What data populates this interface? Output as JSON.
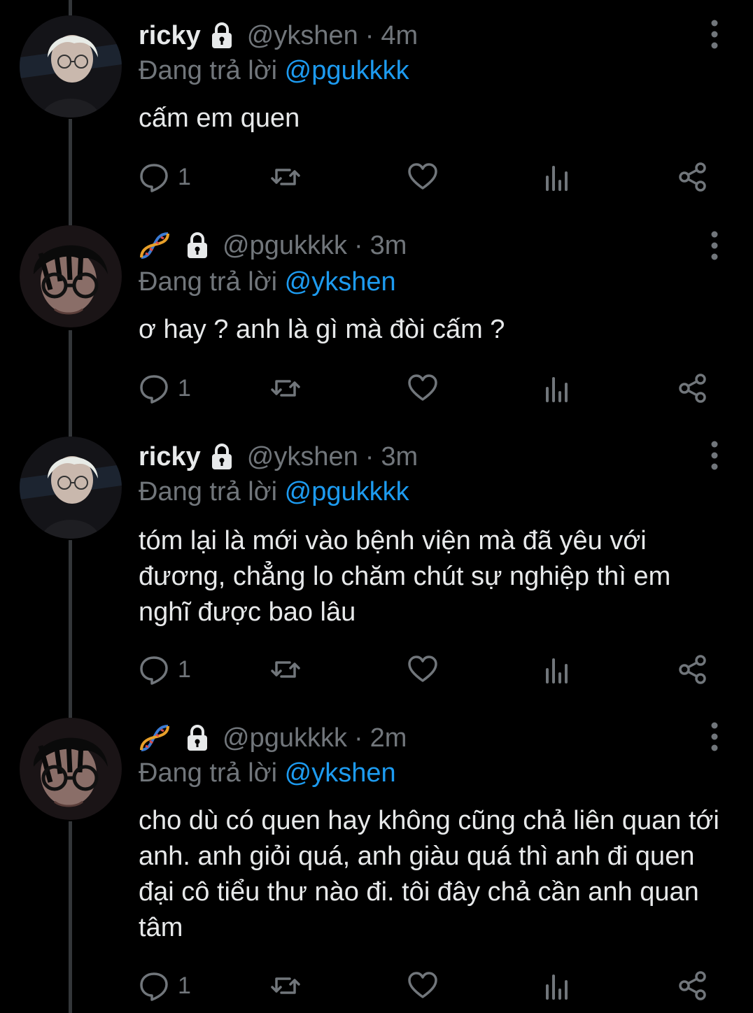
{
  "colors": {
    "background": "#000000",
    "text": "#e7e9ea",
    "muted": "#71767b",
    "mention": "#1d9bf0",
    "thread_line": "#333639"
  },
  "reply_prefix": "Đang trả lời",
  "tweets": [
    {
      "display_name": "ricky",
      "name_icon": "lock-icon",
      "handle": "@ykshen",
      "separator": "·",
      "time": "4m",
      "reply_to": "@pgukkkk",
      "text": "cấm em quen",
      "reply_count": "1"
    },
    {
      "display_name": "",
      "name_icon": "dna-emoji-icon",
      "handle": "@pgukkkk",
      "separator": "·",
      "time": "3m",
      "reply_to": "@ykshen",
      "text": "ơ hay ? anh là gì mà đòi cấm ?",
      "reply_count": "1"
    },
    {
      "display_name": "ricky",
      "name_icon": "lock-icon",
      "handle": "@ykshen",
      "separator": "·",
      "time": "3m",
      "reply_to": "@pgukkkk",
      "text": "tóm lại là mới vào bệnh viện mà đã yêu với đương, chẳng lo chăm chút sự nghiệp thì em nghĩ được bao lâu",
      "reply_count": "1"
    },
    {
      "display_name": "",
      "name_icon": "dna-emoji-icon",
      "handle": "@pgukkkk",
      "separator": "·",
      "time": "2m",
      "reply_to": "@ykshen",
      "text": "cho dù có quen hay không cũng chả liên quan tới anh. anh giỏi quá, anh giàu quá thì anh đi quen đại cô tiểu thư nào đi. tôi đây chả cần anh quan tâm",
      "reply_count": "1"
    }
  ]
}
